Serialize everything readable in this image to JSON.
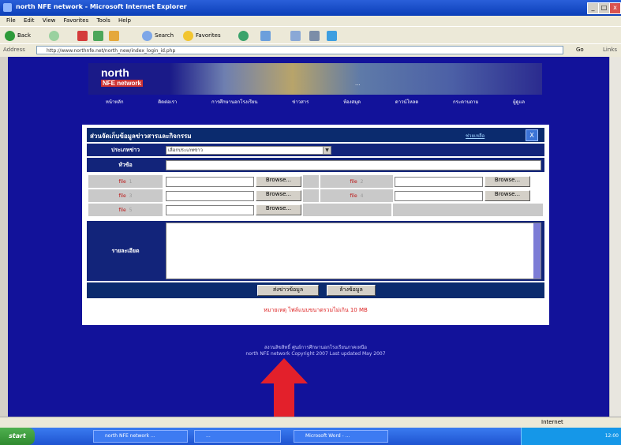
{
  "window": {
    "title": "north NFE network - Microsoft Internet Explorer",
    "menu": [
      "File",
      "Edit",
      "View",
      "Favorites",
      "Tools",
      "Help"
    ],
    "controls": [
      "_",
      "□",
      "x"
    ]
  },
  "toolbar": {
    "back": "Back",
    "search": "Search",
    "favorites": "Favorites"
  },
  "address": {
    "label": "Address",
    "url": "http://www.northnfe.net/north_new/index_login_id.php",
    "go": "Go",
    "links": "Links"
  },
  "banner": {
    "logo_main": "north",
    "logo_sub": "NFE network",
    "tagline": "..."
  },
  "nav": [
    "หน้าหลัก",
    "ติดต่อเรา",
    "การศึกษานอกโรงเรียน",
    "ข่าวสาร",
    "ห้องสมุด",
    "ดาวน์โหลด",
    "กระดานถาม",
    "ผู้ดูแล"
  ],
  "form": {
    "title": "ส่วนจัดเก็บข้อมูลข่าวสารและกิจกรรม",
    "help_link": "ช่วยเหลือ",
    "close": "X",
    "category_label": "ประเภทข่าว",
    "category_value": "เลือกประเภทข่าว",
    "subject_label": "หัวข้อ",
    "file_label": "file",
    "browse": "Browse...",
    "detail_label": "รายละเอียด",
    "submit": "ส่งข่าวข้อมูล",
    "reset": "ล้างข้อมูล",
    "warning": "หมายเหตุ ไฟล์แนบขนาดรวมไม่เกิน 10 MB"
  },
  "footer": {
    "line1": "สงวนลิขสิทธิ์ ศูนย์การศึกษานอกโรงเรียนภาคเหนือ",
    "line2": "north NFE network  Copyright 2007  Last updated May 2007"
  },
  "status": {
    "zone": "Internet"
  },
  "taskbar": {
    "start": "start",
    "tasks": [
      "north NFE network ...",
      "...",
      "Microsoft Word - ..."
    ],
    "clock": "12:00"
  },
  "colors": {
    "page_bg": "#12129a",
    "form_header": "#0b2b6e",
    "arrow": "#e3202b"
  }
}
